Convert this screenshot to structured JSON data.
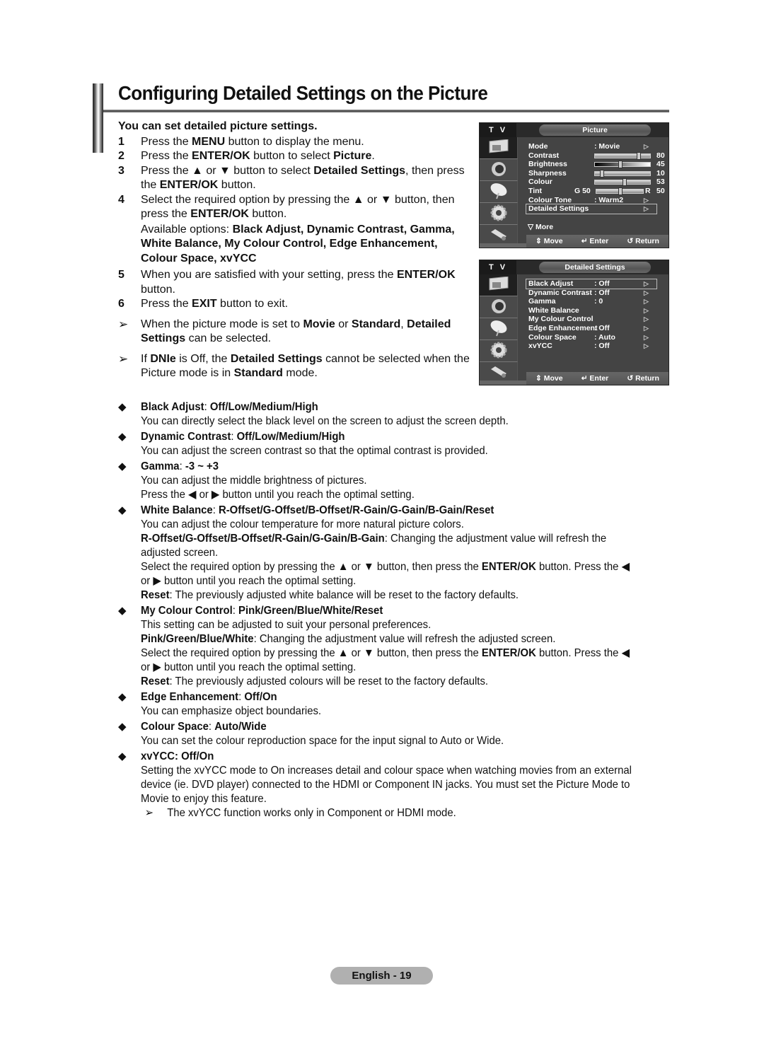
{
  "page": {
    "title": "Configuring Detailed Settings on the Picture",
    "page_label": "English - 19"
  },
  "intro": {
    "lead": "You can set detailed picture settings.",
    "steps": [
      {
        "num": "1",
        "pre": "Press the ",
        "b1": "MENU",
        "post": " button to display the menu."
      },
      {
        "num": "2",
        "pre": "Press the ",
        "b1": "ENTER/OK",
        "mid": " button to select ",
        "b2": "Picture",
        "post": "."
      },
      {
        "num": "3",
        "pre": "Press the ▲ or ▼ button to select ",
        "b1": "Detailed Settings",
        "mid": ", then press the ",
        "b2": "ENTER/OK",
        "post": " button."
      },
      {
        "num": "4",
        "pre": "Select the required option by pressing the ▲ or ▼ button, then press the ",
        "b1": "ENTER/OK",
        "post": " button."
      },
      {
        "num": "5",
        "pre": "When you are satisfied with your setting, press the ",
        "b1": "ENTER/OK",
        "post": " button."
      },
      {
        "num": "6",
        "pre": "Press the ",
        "b1": "EXIT",
        "post": " button to exit."
      }
    ],
    "available_prefix": "Available options: ",
    "available_options": "Black Adjust, Dynamic Contrast, Gamma, White Balance, My Colour Control, Edge Enhancement, Colour Space, xvYCC",
    "notes": [
      {
        "pre": "When the picture mode is set to ",
        "b1": "Movie",
        "mid": " or ",
        "b2": "Standard",
        "mid2": ", ",
        "b3": "Detailed Settings",
        "post": " can be selected."
      },
      {
        "pre": "If ",
        "b1": "DNIe",
        "mid": " is Off, the ",
        "b2": "Detailed Settings",
        "mid2": " cannot be selected when the Picture mode is in ",
        "b3": "Standard",
        "post": " mode."
      }
    ],
    "note_arrow": "➢"
  },
  "tv_common": {
    "tv_label": "T V",
    "footer": {
      "move": "⇕ Move",
      "enter": "↵ Enter",
      "return": "↺ Return"
    },
    "side_icons": [
      "picture-icon",
      "sound-icon",
      "channel-icon",
      "setup-icon",
      "input-icon"
    ]
  },
  "tv_picture": {
    "title": "Picture",
    "rows": [
      {
        "label": "Mode",
        "value": ": Movie",
        "arrow": true
      },
      {
        "label": "Contrast",
        "slider": 80,
        "num": "80"
      },
      {
        "label": "Brightness",
        "slider": 45,
        "num": "45"
      },
      {
        "label": "Sharpness",
        "slider": 10,
        "num": "10"
      },
      {
        "label": "Colour",
        "slider": 53,
        "num": "53"
      },
      {
        "label": "Tint",
        "left": "G  50",
        "slider": 50,
        "right": "R",
        "num": "50"
      },
      {
        "label": "Colour Tone",
        "value": ": Warm2",
        "arrow": true
      },
      {
        "label": "Detailed Settings",
        "arrow": true,
        "selected": true
      }
    ],
    "more": "▽  More"
  },
  "tv_detailed": {
    "title": "Detailed Settings",
    "rows": [
      {
        "label": "Black Adjust",
        "value": ": Off",
        "selected": true
      },
      {
        "label": "Dynamic Contrast",
        "value": ": Off"
      },
      {
        "label": "Gamma",
        "value": ":    0"
      },
      {
        "label": "White Balance",
        "value": ""
      },
      {
        "label": "My Colour Control",
        "value": ""
      },
      {
        "label": "Edge Enhancement",
        "value": ": Off"
      },
      {
        "label": "Colour Space",
        "value": ": Auto"
      },
      {
        "label": "xvYCC",
        "value": ": Off"
      }
    ]
  },
  "bullets": [
    {
      "name": "Black Adjust",
      "options": "Off/Low/Medium/High",
      "lines": [
        {
          "text": "You can directly select the black level on the screen to adjust the screen depth."
        }
      ]
    },
    {
      "name": "Dynamic Contrast",
      "options": "Off/Low/Medium/High",
      "lines": [
        {
          "text": "You can adjust the screen contrast so that the optimal contrast is provided."
        }
      ]
    },
    {
      "name": "Gamma",
      "options": "-3 ~ +3",
      "lines": [
        {
          "text": "You can adjust the middle brightness of pictures."
        },
        {
          "text": "Press the ◀ or ▶ button until you reach the optimal setting."
        }
      ]
    },
    {
      "name": "White Balance",
      "options": "R-Offset/G-Offset/B-Offset/R-Gain/G-Gain/B-Gain/Reset",
      "lines": [
        {
          "text": "You can adjust the colour temperature for more natural picture colors."
        },
        {
          "bold": "R-Offset/G-Offset/B-Offset/R-Gain/G-Gain/B-Gain",
          "text": ": Changing the adjustment value will refresh the adjusted screen."
        },
        {
          "text": "Select the required option by pressing the ▲ or ▼ button, then press the ",
          "bold_after": "ENTER/OK",
          "text_after": " button. Press the ◀ or ▶ button until you reach the optimal setting."
        },
        {
          "bold": "Reset",
          "text": ": The previously adjusted white balance will be reset to the factory defaults."
        }
      ]
    },
    {
      "name": "My Colour Control",
      "options": "Pink/Green/Blue/White/Reset",
      "lines": [
        {
          "text": "This setting can be adjusted to suit your personal preferences."
        },
        {
          "bold": "Pink/Green/Blue/White",
          "text": ": Changing the adjustment value will refresh the adjusted screen."
        },
        {
          "text": "Select the required option by pressing the ▲ or ▼ button, then press the ",
          "bold_after": "ENTER/OK",
          "text_after": " button. Press the ◀ or ▶ button until you reach the optimal setting."
        },
        {
          "bold": "Reset",
          "text": ": The previously adjusted colours will be reset to the factory defaults."
        }
      ]
    },
    {
      "name": "Edge Enhancement",
      "options": "Off/On",
      "lines": [
        {
          "text": "You can emphasize object boundaries."
        }
      ]
    },
    {
      "name": "Colour Space",
      "options": "Auto/Wide",
      "lines": [
        {
          "text": "You can set the colour reproduction space for the input signal to Auto or Wide."
        }
      ]
    },
    {
      "name": "xvYCC",
      "options": "Off/On",
      "colon_bold": true,
      "lines": [
        {
          "text": "Setting the xvYCC mode to On increases detail and colour space when watching movies from an external device (ie. DVD player) connected to the HDMI or Component IN jacks. You must set the Picture Mode to Movie to enjoy this feature."
        }
      ],
      "note": "The xvYCC function works only in Component or HDMI mode."
    }
  ],
  "bullet_glyph": "◆"
}
